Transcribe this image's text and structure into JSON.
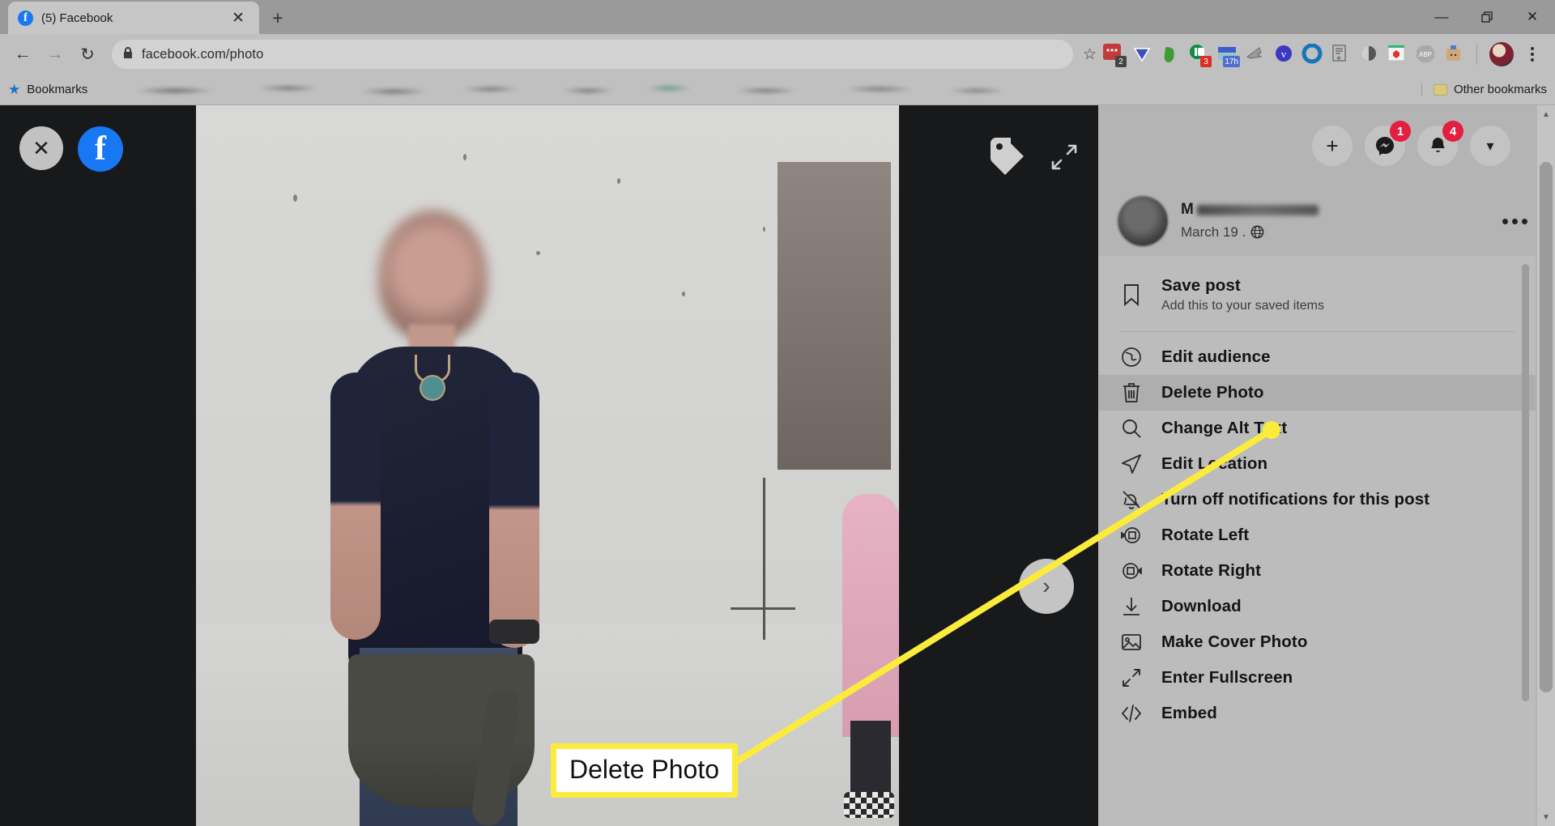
{
  "browser": {
    "tab": {
      "title": "(5) Facebook",
      "favicon": "facebook-icon",
      "close": "✕"
    },
    "new_tab_label": "+",
    "window_controls": {
      "minimize": "—",
      "maximize": "❐",
      "close": "✕"
    },
    "nav": {
      "back": "←",
      "forward": "→",
      "reload": "↻"
    },
    "omnibox": {
      "lock_icon": "lock-icon",
      "url": "facebook.com/photo",
      "star_icon": "☆"
    },
    "extensions": [
      {
        "name": "pocket-extension",
        "badge": "2"
      },
      {
        "name": "diamond-extension",
        "badge": ""
      },
      {
        "name": "evernote-extension",
        "badge": ""
      },
      {
        "name": "lastpass-extension",
        "badge": "3"
      },
      {
        "name": "toggl-extension",
        "badge": "17h"
      },
      {
        "name": "grammarly-extension",
        "badge": ""
      },
      {
        "name": "vimeo-extension",
        "badge": ""
      },
      {
        "name": "circle-extension",
        "badge": ""
      },
      {
        "name": "notes-extension",
        "badge": ""
      },
      {
        "name": "moon-extension",
        "badge": ""
      },
      {
        "name": "ghostery-extension",
        "badge": ""
      },
      {
        "name": "adblock-plus-extension",
        "badge": "ABP"
      },
      {
        "name": "honey-extension",
        "badge": ""
      }
    ],
    "profile_label": "avatar",
    "menu_label": "⋮",
    "bookmarks": {
      "label": "Bookmarks",
      "star_icon": "bookmark-star-icon",
      "other_label": "Other bookmarks",
      "folder_icon": "folder-icon"
    }
  },
  "viewer": {
    "close_label": "✕",
    "logo_label": "f",
    "tag_icon": "tag-icon",
    "expand_icon": "expand-icon",
    "next_label": "›"
  },
  "topnav": {
    "create": {
      "name": "create-button",
      "glyph": "+",
      "badge": ""
    },
    "messenger": {
      "name": "messenger-button",
      "glyph": "messenger-icon",
      "badge": "1"
    },
    "notifications": {
      "name": "notifications-button",
      "glyph": "bell-icon",
      "badge": "4"
    },
    "account": {
      "name": "account-menu-button",
      "glyph": "▾",
      "badge": ""
    }
  },
  "post": {
    "author_initial": "M",
    "date": "March 19 .",
    "audience_icon": "globe-icon",
    "options_label": "post-options"
  },
  "menu": {
    "items": [
      {
        "label": "Save post",
        "sub": "Add this to your saved items",
        "icon": "bookmark-icon",
        "highlight": false,
        "tall": true
      },
      {
        "label": "Edit audience",
        "sub": "",
        "icon": "globe-icon",
        "highlight": false,
        "tall": false
      },
      {
        "label": "Delete Photo",
        "sub": "",
        "icon": "trash-icon",
        "highlight": true,
        "tall": false
      },
      {
        "label": "Change Alt Text",
        "sub": "",
        "icon": "search-icon",
        "highlight": false,
        "tall": false
      },
      {
        "label": "Edit Location",
        "sub": "",
        "icon": "location-arrow-icon",
        "highlight": false,
        "tall": false
      },
      {
        "label": "Turn off notifications for this post",
        "sub": "",
        "icon": "bell-slash-icon",
        "highlight": false,
        "tall": false
      },
      {
        "label": "Rotate Left",
        "sub": "",
        "icon": "rotate-left-icon",
        "highlight": false,
        "tall": false
      },
      {
        "label": "Rotate Right",
        "sub": "",
        "icon": "rotate-right-icon",
        "highlight": false,
        "tall": false
      },
      {
        "label": "Download",
        "sub": "",
        "icon": "download-icon",
        "highlight": false,
        "tall": false
      },
      {
        "label": "Make Cover Photo",
        "sub": "",
        "icon": "image-icon",
        "highlight": false,
        "tall": false
      },
      {
        "label": "Enter Fullscreen",
        "sub": "",
        "icon": "fullscreen-icon",
        "highlight": false,
        "tall": false
      },
      {
        "label": "Embed",
        "sub": "",
        "icon": "code-icon",
        "highlight": false,
        "tall": false
      }
    ]
  },
  "annotation": {
    "callout_text": "Delete Photo",
    "line_color": "#fbec3c"
  }
}
